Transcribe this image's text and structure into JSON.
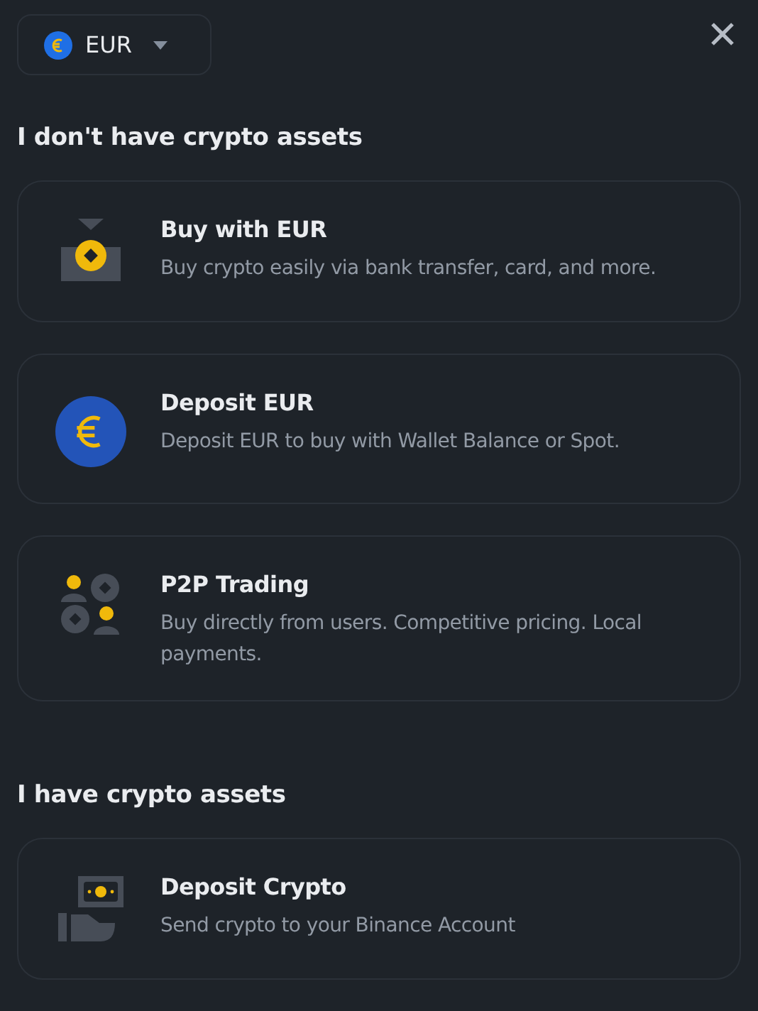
{
  "currency_selector": {
    "label": "EUR"
  },
  "sections": [
    {
      "heading": "I don't have crypto assets",
      "options": [
        {
          "kind": "buy",
          "title": "Buy with EUR",
          "description": "Buy crypto easily via bank transfer, card, and more."
        },
        {
          "kind": "fiat",
          "title": "Deposit EUR",
          "description": "Deposit EUR to buy with Wallet Balance or Spot."
        },
        {
          "kind": "p2p",
          "title": "P2P Trading",
          "description": "Buy directly from users. Competitive pricing. Local payments."
        }
      ]
    },
    {
      "heading": "I have crypto assets",
      "options": [
        {
          "kind": "crypto",
          "title": "Deposit Crypto",
          "description": "Send crypto to your Binance Account"
        }
      ]
    }
  ]
}
